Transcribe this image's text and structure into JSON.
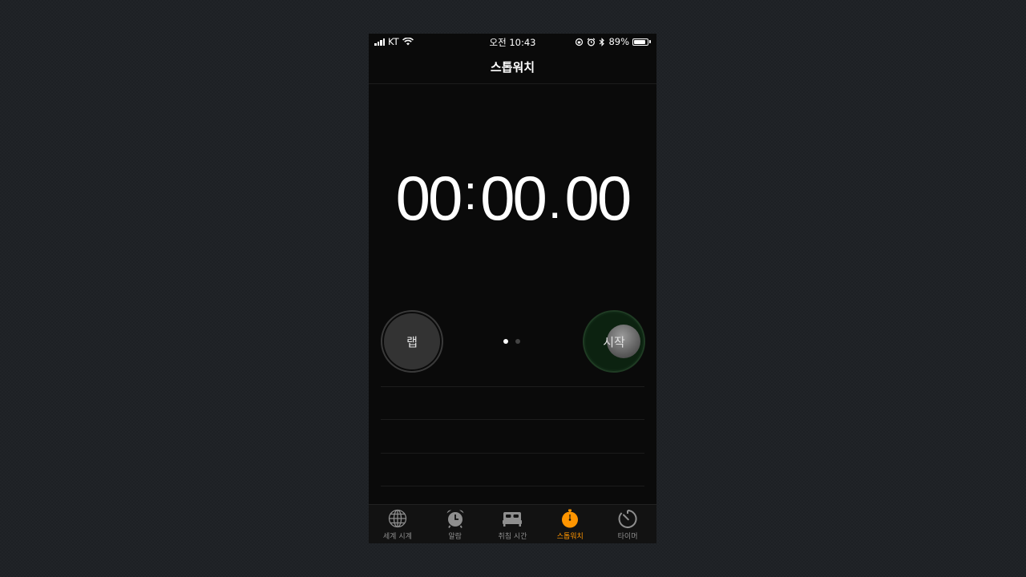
{
  "status_bar": {
    "carrier": "KT",
    "time": "오전 10:43",
    "battery": "89%",
    "battery_level": 0.89
  },
  "nav": {
    "title": "스톱워치"
  },
  "stopwatch": {
    "minutes": "00",
    "seconds": "00",
    "hundredths": "00",
    "colon": ":",
    "dot": "."
  },
  "buttons": {
    "lap_label": "랩",
    "start_label": "시작"
  },
  "page_indicator": {
    "count": 2,
    "active": 0
  },
  "tabs": [
    {
      "label": "세계 시계",
      "icon": "globe-icon"
    },
    {
      "label": "알람",
      "icon": "alarm-clock-icon"
    },
    {
      "label": "취침 시간",
      "icon": "bed-icon"
    },
    {
      "label": "스톱워치",
      "icon": "stopwatch-icon",
      "active": true
    },
    {
      "label": "타이머",
      "icon": "timer-icon"
    }
  ],
  "colors": {
    "accent": "#ff9500",
    "start_button": "#0f2714",
    "lap_button": "#333333",
    "background": "#0a0a0a"
  }
}
